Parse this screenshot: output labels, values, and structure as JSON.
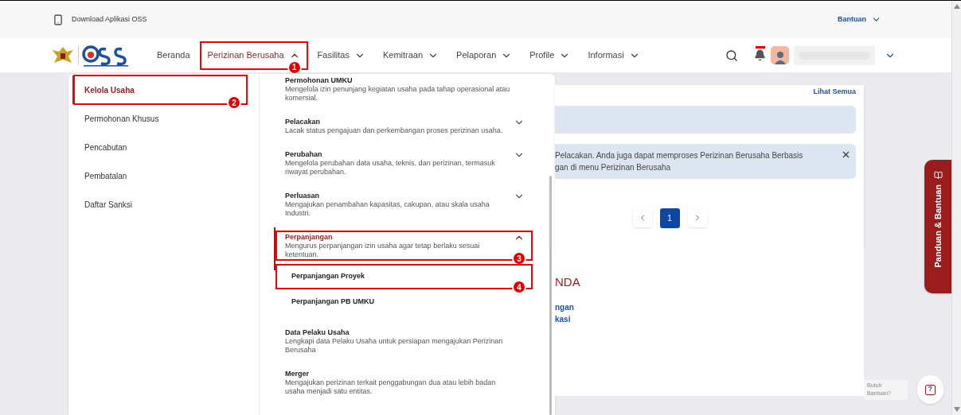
{
  "top_bar": {
    "download_label": "Download Aplikasi OSS",
    "help_menu": "Bantuan"
  },
  "nav": {
    "items": [
      {
        "kind": "link",
        "label": "Beranda",
        "selected": false
      },
      {
        "kind": "dropdown",
        "label": "Perizinan Berusaha",
        "expanded": true,
        "selected": true,
        "annotation": "1"
      },
      {
        "kind": "dropdown",
        "label": "Fasilitas",
        "expanded": false,
        "selected": false
      },
      {
        "kind": "dropdown",
        "label": "Kemitraan",
        "expanded": false,
        "selected": false
      },
      {
        "kind": "dropdown",
        "label": "Pelaporan",
        "expanded": false,
        "selected": false
      },
      {
        "kind": "dropdown",
        "label": "Profile",
        "expanded": false,
        "selected": false
      },
      {
        "kind": "dropdown",
        "label": "Informasi",
        "expanded": false,
        "selected": false
      }
    ],
    "notification": true
  },
  "menu": {
    "categories": [
      {
        "label": "Kelola Usaha",
        "selected": true,
        "annotation": "2"
      },
      {
        "label": "Permohonan Khusus",
        "selected": false
      },
      {
        "label": "Pencabutan",
        "selected": false
      },
      {
        "label": "Pembatalan",
        "selected": false
      },
      {
        "label": "Daftar Sanksi",
        "selected": false
      }
    ],
    "items": [
      {
        "kind": "link",
        "title": "Permohonan UMKU",
        "description": "Mengelola izin penunjang kegiatan usaha pada tahap operasional atau komersial."
      },
      {
        "kind": "group",
        "title": "Pelacakan",
        "description": "Lacak status pengajuan dan perkembangan proses perizinan usaha.",
        "expanded": false
      },
      {
        "kind": "group",
        "title": "Perubahan",
        "description": "Mengelola perubahan data usaha, teknis, dan perizinan, termasuk riwayat perubahan.",
        "expanded": false
      },
      {
        "kind": "group",
        "title": "Perluasan",
        "description": "Mengajukan penambahan kapasitas, cakupan, atau skala usaha Industri.",
        "expanded": false
      },
      {
        "kind": "group",
        "title": "Perpanjangan",
        "description": "Mengurus perpanjangan izin usaha agar tetap berlaku sesuai ketentuan.",
        "expanded": true,
        "annotation": "3",
        "children": [
          {
            "label": "Perpanjangan Proyek",
            "annotation": "4"
          },
          {
            "label": "Perpanjangan PB UMKU"
          }
        ]
      },
      {
        "kind": "link",
        "title": "Data Pelaku Usaha",
        "description": "Lengkapi data Pelaku Usaha untuk persiapan mengajukan Perizinan Berusaha"
      },
      {
        "kind": "link",
        "title": "Merger",
        "description": "Mengajukan perizinan terkait penggabungan dua atau lebih badan usaha menjadi satu entitas."
      }
    ]
  },
  "content": {
    "link": "Lihat Semua",
    "alert_lines": [
      "Pelacakan. Anda juga dapat memproses Perizinan Berusaha Berbasis",
      "gan di menu Perizinan Berusaha"
    ],
    "pagination": [
      {
        "label": "1",
        "selected": true
      }
    ],
    "section_title": "NDA",
    "links": [
      "ngan",
      "kasi"
    ]
  },
  "side_tab": "Panduan & Bantuan",
  "help": {
    "bubble": "Butuh Bantuan?",
    "icon": "?"
  }
}
